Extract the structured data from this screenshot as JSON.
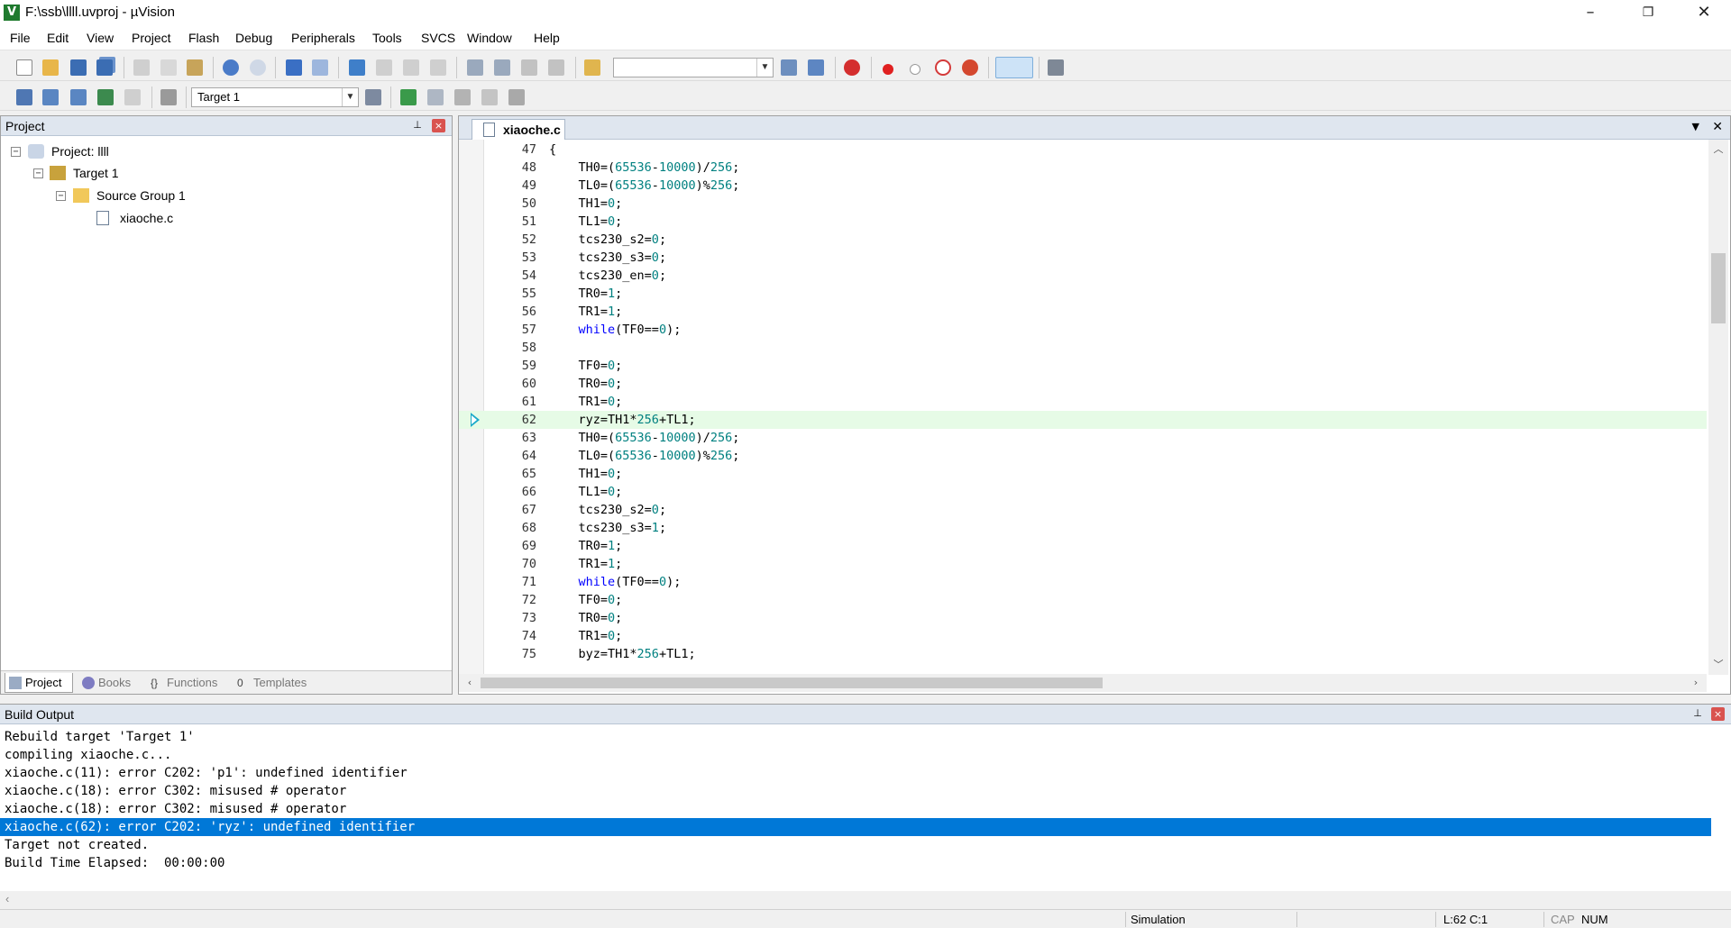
{
  "window": {
    "title": "F:\\ssb\\llll.uvproj - µVision",
    "app_icon": "V",
    "minimize": "–",
    "restore": "❐",
    "close": "✕"
  },
  "menu": [
    "File",
    "Edit",
    "View",
    "Project",
    "Flash",
    "Debug",
    "Peripherals",
    "Tools",
    "SVCS",
    "Window",
    "Help"
  ],
  "toolbar": {
    "target_select": "Target 1",
    "combo_arrow": "▼"
  },
  "project_pane": {
    "header": "Project",
    "pin": "📌",
    "close": "×",
    "tree": {
      "root": "Project: llll",
      "target": "Target 1",
      "group": "Source Group 1",
      "file": "xiaoche.c"
    },
    "tabs": [
      "Project",
      "Books",
      "Functions",
      "Templates"
    ]
  },
  "editor": {
    "tab": "xiaoche.c",
    "dropdown_icon": "▼",
    "close_icon": "✕",
    "current_line": 62,
    "lines": [
      {
        "n": "47",
        "html": "{"
      },
      {
        "n": "48",
        "html": "    TH0=(<span class=\"num\">65536</span>-<span class=\"num\">10000</span>)/<span class=\"num\">256</span>;"
      },
      {
        "n": "49",
        "html": "    TL0=(<span class=\"num\">65536</span>-<span class=\"num\">10000</span>)%<span class=\"num\">256</span>;"
      },
      {
        "n": "50",
        "html": "    TH1=<span class=\"num\">0</span>;"
      },
      {
        "n": "51",
        "html": "    TL1=<span class=\"num\">0</span>;"
      },
      {
        "n": "52",
        "html": "    tcs230_s2=<span class=\"num\">0</span>;"
      },
      {
        "n": "53",
        "html": "    tcs230_s3=<span class=\"num\">0</span>;"
      },
      {
        "n": "54",
        "html": "    tcs230_en=<span class=\"num\">0</span>;"
      },
      {
        "n": "55",
        "html": "    TR0=<span class=\"num\">1</span>;"
      },
      {
        "n": "56",
        "html": "    TR1=<span class=\"num\">1</span>;"
      },
      {
        "n": "57",
        "html": "    <span class=\"kw\">while</span>(TF0==<span class=\"num\">0</span>);"
      },
      {
        "n": "58",
        "html": ""
      },
      {
        "n": "59",
        "html": "    TF0=<span class=\"num\">0</span>;"
      },
      {
        "n": "60",
        "html": "    TR0=<span class=\"num\">0</span>;"
      },
      {
        "n": "61",
        "html": "    TR1=<span class=\"num\">0</span>;"
      },
      {
        "n": "62",
        "html": "    ryz=TH1*<span class=\"num\">256</span>+TL1;"
      },
      {
        "n": "63",
        "html": "    TH0=(<span class=\"num\">65536</span>-<span class=\"num\">10000</span>)/<span class=\"num\">256</span>;"
      },
      {
        "n": "64",
        "html": "    TL0=(<span class=\"num\">65536</span>-<span class=\"num\">10000</span>)%<span class=\"num\">256</span>;"
      },
      {
        "n": "65",
        "html": "    TH1=<span class=\"num\">0</span>;"
      },
      {
        "n": "66",
        "html": "    TL1=<span class=\"num\">0</span>;"
      },
      {
        "n": "67",
        "html": "    tcs230_s2=<span class=\"num\">0</span>;"
      },
      {
        "n": "68",
        "html": "    tcs230_s3=<span class=\"num\">1</span>;"
      },
      {
        "n": "69",
        "html": "    TR0=<span class=\"num\">1</span>;"
      },
      {
        "n": "70",
        "html": "    TR1=<span class=\"num\">1</span>;"
      },
      {
        "n": "71",
        "html": "    <span class=\"kw\">while</span>(TF0==<span class=\"num\">0</span>);"
      },
      {
        "n": "72",
        "html": "    TF0=<span class=\"num\">0</span>;"
      },
      {
        "n": "73",
        "html": "    TR0=<span class=\"num\">0</span>;"
      },
      {
        "n": "74",
        "html": "    TR1=<span class=\"num\">0</span>;"
      },
      {
        "n": "75",
        "html": "    byz=TH1*<span class=\"num\">256</span>+TL1;"
      }
    ]
  },
  "build_output": {
    "header": "Build Output",
    "lines": [
      "Rebuild target 'Target 1'",
      "compiling xiaoche.c...",
      "xiaoche.c(11): error C202: 'p1': undefined identifier",
      "xiaoche.c(18): error C302: misused # operator",
      "xiaoche.c(18): error C302: misused # operator",
      "xiaoche.c(62): error C202: 'ryz': undefined identifier",
      "Target not created.",
      "Build Time Elapsed:  00:00:00"
    ],
    "selected_index": 5
  },
  "statusbar": {
    "mode": "Simulation",
    "position": "L:62 C:1",
    "cap": "CAP",
    "num": "NUM"
  },
  "colors": {
    "selection": "#0078d7",
    "current_line": "#e6fbe6",
    "keyword": "#0000ff",
    "number": "#008080",
    "pane_header": "#dfe6ef"
  }
}
